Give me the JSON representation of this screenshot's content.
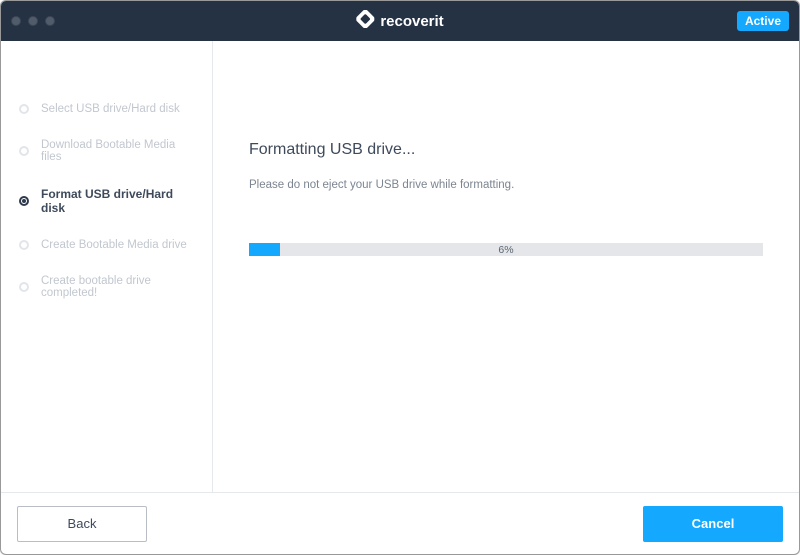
{
  "header": {
    "brand": "recoverit",
    "active_badge": "Active"
  },
  "sidebar": {
    "steps": [
      {
        "label": "Select USB drive/Hard disk",
        "active": false
      },
      {
        "label": "Download Bootable Media files",
        "active": false
      },
      {
        "label": "Format USB drive/Hard disk",
        "active": true
      },
      {
        "label": "Create Bootable Media drive",
        "active": false
      },
      {
        "label": "Create bootable drive completed!",
        "active": false
      }
    ]
  },
  "main": {
    "heading": "Formatting USB drive...",
    "subtext": "Please do not eject your USB drive while formatting.",
    "progress_percent": 6,
    "progress_label": "6%"
  },
  "footer": {
    "back_label": "Back",
    "cancel_label": "Cancel"
  },
  "colors": {
    "accent": "#14a8ff",
    "titlebar": "#253244"
  }
}
